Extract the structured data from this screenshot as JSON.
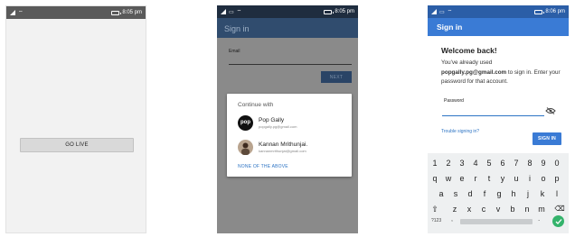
{
  "screen1": {
    "status": {
      "signal": "ᵀ↑↓l .ıl",
      "time": "8:05 pm"
    },
    "go_live_label": "GO LIVE"
  },
  "screen2": {
    "status": {
      "time": "8:05 pm"
    },
    "appbar_title": "Sign in",
    "email_label": "Email",
    "next_label": "NEXT",
    "dialog": {
      "title": "Continue with",
      "accounts": [
        {
          "name": "Pop Gally",
          "email": "popgally.pg@gmail.com",
          "avatar_text": "pop"
        },
        {
          "name": "Kannan Mrithunjai.",
          "email": "kannanmrithunjai@gmail.com",
          "avatar_text": ""
        }
      ],
      "none_label": "NONE OF THE ABOVE"
    }
  },
  "screen3": {
    "status": {
      "time": "8:06 pm"
    },
    "appbar_title": "Sign in",
    "welcome": "Welcome back!",
    "desc_prefix": "You've already used",
    "desc_email": "popgally.pg@gmail.com",
    "desc_suffix": "to sign in. Enter your password for that account.",
    "password_label": "Password",
    "trouble_label": "Trouble signing in?",
    "sign_in_label": "SIGN IN",
    "keyboard": {
      "row_numbers": [
        "1",
        "2",
        "3",
        "4",
        "5",
        "6",
        "7",
        "8",
        "9",
        "0"
      ],
      "row1": [
        "q",
        "w",
        "e",
        "r",
        "t",
        "y",
        "u",
        "i",
        "o",
        "p"
      ],
      "row2": [
        "a",
        "s",
        "d",
        "f",
        "g",
        "h",
        "j",
        "k",
        "l"
      ],
      "row3": [
        "z",
        "x",
        "c",
        "v",
        "b",
        "n",
        "m"
      ],
      "mode_label": "?123",
      "comma": ",",
      "period": "."
    }
  },
  "colors": {
    "blue_primary": "#3a7bd5",
    "dark_appbar": "#304c6e",
    "link_blue": "#2d74c4",
    "enter_green": "#34b36b"
  }
}
